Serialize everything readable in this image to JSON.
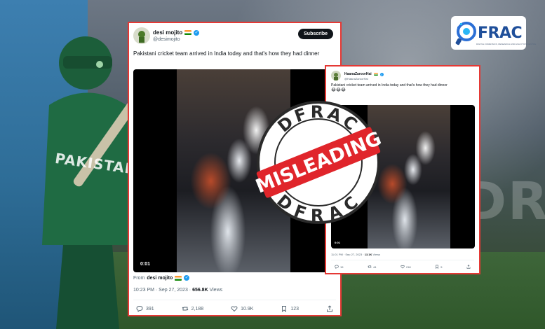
{
  "logo": {
    "brand": "FRAC",
    "tagline": "DIGITAL FORENSICS, RESEARCH AND ANALYTICS CENTRE"
  },
  "background": {
    "jersey_text": "PAKISTAN",
    "right_word": "DR"
  },
  "main_tweet": {
    "display_name": "desi mojito",
    "handle": "@desimojito",
    "subscribe_label": "Subscribe",
    "text": "Pakistani cricket team arrived in India today and that's how they had dinner",
    "video_time": "0:01",
    "from_prefix": "From",
    "from_name": "desi mojito",
    "timestamp": "10:23 PM · Sep 27, 2023 · ",
    "views_count": "656.8K",
    "views_label": " Views",
    "replies": "391",
    "reposts": "2,188",
    "likes": "10.9K",
    "bookmarks": "123"
  },
  "small_tweet": {
    "display_name": "HaanaZaroorHai",
    "handle": "@HaanaZaroorHai",
    "text": "Pakistani cricket team arrived in India today and that's how they had dinner",
    "emojis": "😂😂😂",
    "video_time": "0:01",
    "timestamp": "11:01 PM · Sep 27, 2023 · ",
    "views_count": "13.1K",
    "views_label": " Views",
    "replies": "15",
    "reposts": "44",
    "likes": "218",
    "bookmarks": "5"
  },
  "stamp": {
    "top_text": "DFRAC",
    "bottom_text": "DFRAC",
    "label": "MISLEADING",
    "color": "#e0252b"
  },
  "colors": {
    "card_border": "#e53935",
    "verified": "#1d9bf0",
    "logo_blue": "#1f4f9a"
  }
}
